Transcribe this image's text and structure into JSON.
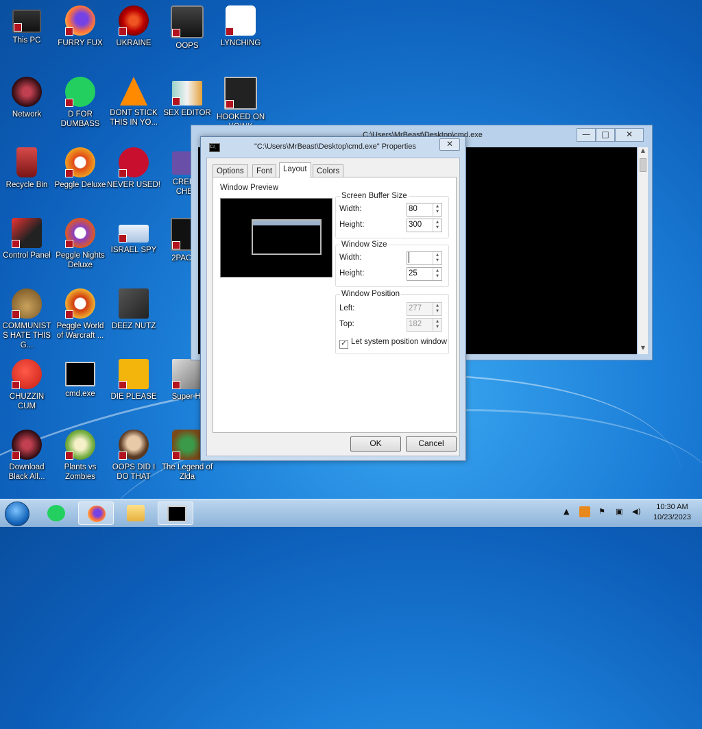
{
  "desktop": {
    "icons": [
      {
        "label": "This PC"
      },
      {
        "label": "FURRY FUX"
      },
      {
        "label": "UKRAINE"
      },
      {
        "label": "OOPS"
      },
      {
        "label": "LYNCHING"
      },
      {
        "label": "Network"
      },
      {
        "label": "D FOR DUMBASS"
      },
      {
        "label": "DONT STICK THIS IN YO..."
      },
      {
        "label": "SEX EDITOR"
      },
      {
        "label": "HOOKED ON YOINK"
      },
      {
        "label": "Recycle Bin"
      },
      {
        "label": "Peggle Deluxe"
      },
      {
        "label": "NEVER USED!"
      },
      {
        "label": "CREDIT CHEC"
      },
      {
        "label": "Control Panel"
      },
      {
        "label": "Peggle Nights Deluxe"
      },
      {
        "label": "ISRAEL SPY"
      },
      {
        "label": "2PACA 2"
      },
      {
        "label": "COMMUNISTS HATE THIS G..."
      },
      {
        "label": "Peggle World of Warcraft ..."
      },
      {
        "label": "DEEZ NUTZ"
      },
      {
        "label": "CHUZZIN CUM"
      },
      {
        "label": "cmd.exe"
      },
      {
        "label": "DIE PLEASE"
      },
      {
        "label": "Super Hi"
      },
      {
        "label": "Download Black All..."
      },
      {
        "label": "Plants vs Zombies"
      },
      {
        "label": "OOPS DID I DO THAT"
      },
      {
        "label": "The Legend of Zlda"
      }
    ]
  },
  "cmd_window": {
    "title": "C:\\Users\\MrBeast\\Desktop\\cmd.exe",
    "minimize": "—",
    "maximize": "□",
    "close": "✕"
  },
  "dialog": {
    "title": "\"C:\\Users\\MrBeast\\Desktop\\cmd.exe\" Properties",
    "icon_text": "C:\\",
    "close": "✕",
    "tabs": [
      "Options",
      "Font",
      "Layout",
      "Colors"
    ],
    "active_tab": "Layout",
    "preview_label": "Window Preview",
    "buffer": {
      "title": "Screen Buffer Size",
      "width_label": "Width:",
      "width": "80",
      "height_label": "Height:",
      "height": "300"
    },
    "window_size": {
      "title": "Window Size",
      "width_label": "Width:",
      "width": "",
      "height_label": "Height:",
      "height": "25"
    },
    "position": {
      "title": "Window Position",
      "left_label": "Left:",
      "left": "277",
      "top_label": "Top:",
      "top": "182",
      "checkbox_label": "Let system position window",
      "checked": true
    },
    "ok": "OK",
    "cancel": "Cancel"
  },
  "taskbar": {
    "time": "10:30 AM",
    "date": "10/23/2023"
  },
  "colors": {
    "accent": "#1c7fd8",
    "title_bar": "#c9dbee",
    "taskbar": "#a6c6e6"
  }
}
